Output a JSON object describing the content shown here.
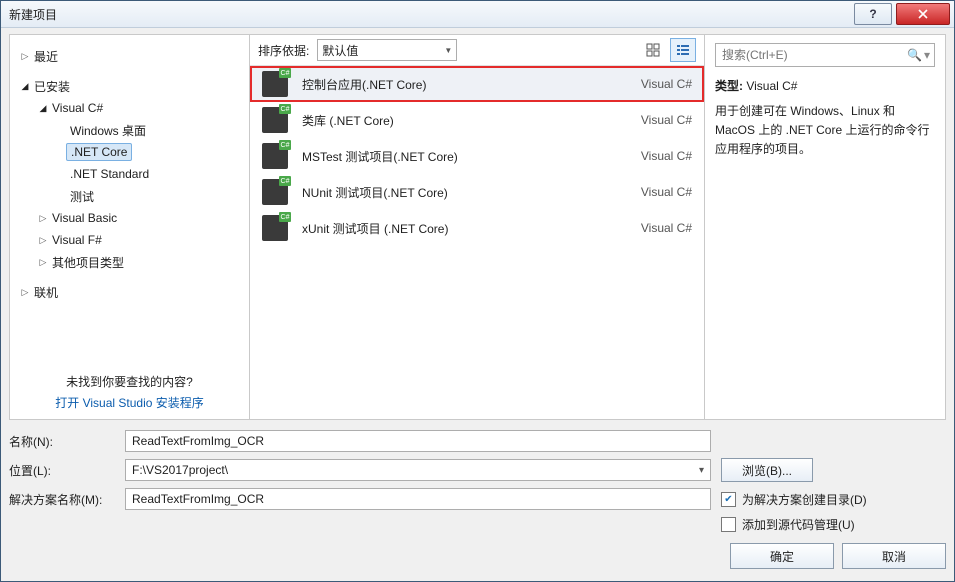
{
  "title": "新建项目",
  "tree": {
    "recent": "最近",
    "installed": "已安装",
    "vc": "Visual C#",
    "vc_items": [
      "Windows 桌面",
      ".NET Core",
      ".NET Standard",
      "测试"
    ],
    "vb": "Visual Basic",
    "vf": "Visual F#",
    "other": "其他项目类型",
    "online": "联机",
    "not_found": "未找到你要查找的内容?",
    "open_installer": "打开 Visual Studio 安装程序"
  },
  "toolbar": {
    "sort_label": "排序依据:",
    "sort_value": "默认值"
  },
  "templates": [
    {
      "name": "控制台应用(.NET Core)",
      "lang": "Visual C#",
      "selected": true
    },
    {
      "name": "类库 (.NET Core)",
      "lang": "Visual C#",
      "selected": false
    },
    {
      "name": "MSTest 测试项目(.NET Core)",
      "lang": "Visual C#",
      "selected": false
    },
    {
      "name": "NUnit 测试项目(.NET Core)",
      "lang": "Visual C#",
      "selected": false
    },
    {
      "name": "xUnit 测试项目 (.NET Core)",
      "lang": "Visual C#",
      "selected": false
    }
  ],
  "details": {
    "search_placeholder": "搜索(Ctrl+E)",
    "type_label": "类型:",
    "type_value": "Visual C#",
    "description": "用于创建可在 Windows、Linux 和 MacOS 上的 .NET Core 上运行的命令行应用程序的项目。"
  },
  "form": {
    "name_label": "名称(N):",
    "name_value": "ReadTextFromImg_OCR",
    "location_label": "位置(L):",
    "location_value": "F:\\VS2017project\\",
    "browse": "浏览(B)...",
    "solution_label": "解决方案名称(M):",
    "solution_value": "ReadTextFromImg_OCR",
    "create_dir": "为解决方案创建目录(D)",
    "add_source": "添加到源代码管理(U)"
  },
  "buttons": {
    "ok": "确定",
    "cancel": "取消"
  }
}
